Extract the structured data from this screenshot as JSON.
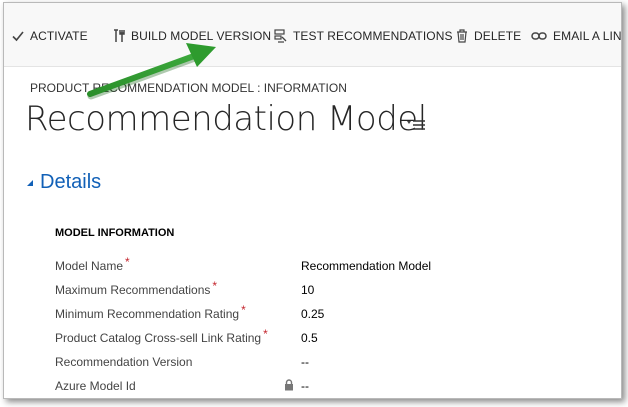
{
  "toolbar": {
    "activate": "ACTIVATE",
    "build_model_version": "BUILD MODEL VERSION",
    "test_recommendations": "TEST RECOMMENDATIONS",
    "delete": "DELETE",
    "email_a_link": "EMAIL A LIN"
  },
  "header": {
    "breadcrumb": "PRODUCT RECOMMENDATION MODEL : INFORMATION",
    "title": "Recommendation Model"
  },
  "section": {
    "title": "Details",
    "subsection_title": "MODEL INFORMATION",
    "fields": [
      {
        "label": "Model Name",
        "required": true,
        "value": "Recommendation Model"
      },
      {
        "label": "Maximum Recommendations",
        "required": true,
        "value": "10"
      },
      {
        "label": "Minimum Recommendation Rating",
        "required": true,
        "value": "0.25"
      },
      {
        "label": "Product Catalog Cross-sell Link Rating",
        "required": true,
        "value": "0.5"
      },
      {
        "label": "Recommendation Version",
        "required": false,
        "value": "--"
      },
      {
        "label": "Azure Model Id",
        "required": false,
        "locked": true,
        "value": "--"
      }
    ]
  },
  "colors": {
    "accent_blue": "#1160b7",
    "required_red": "#c4262e",
    "annotation_arrow": "#2e8b2e"
  },
  "icons": {
    "activate": "checkmark-icon",
    "build": "build-tools-icon",
    "test": "test-recommendations-icon",
    "delete": "trash-icon",
    "email": "link-icon",
    "title_menu": "caret-menu-icon",
    "section_toggle": "expanded-caret-icon",
    "locked_field": "lock-icon"
  }
}
